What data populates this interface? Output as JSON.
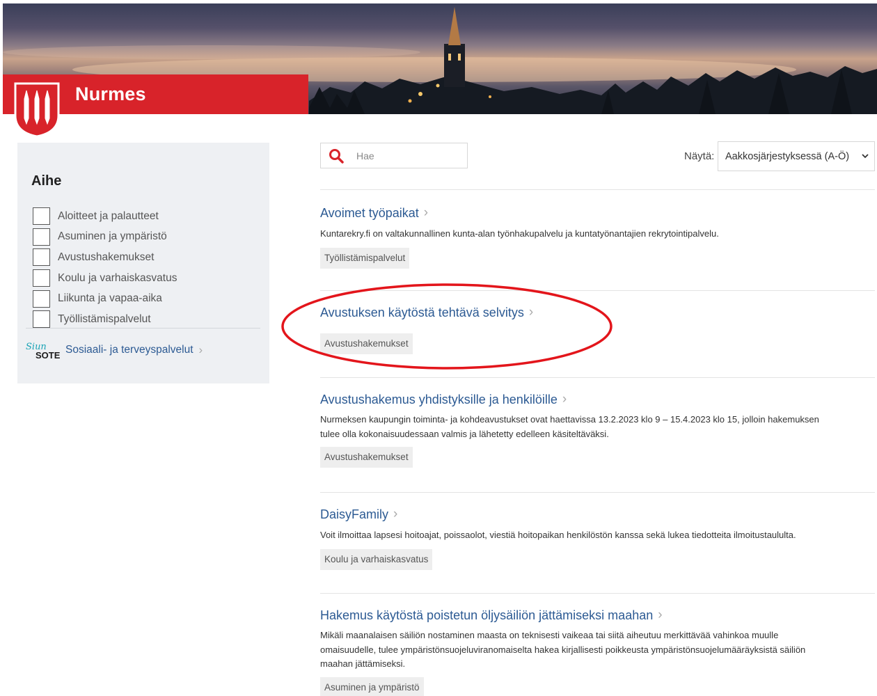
{
  "brand": {
    "title": "Nurmes"
  },
  "sidebar": {
    "heading": "Aihe",
    "filters": [
      {
        "label": "Aloitteet ja palautteet"
      },
      {
        "label": "Asuminen ja ympäristö"
      },
      {
        "label": "Avustushakemukset"
      },
      {
        "label": "Koulu ja varhaiskasvatus"
      },
      {
        "label": "Liikunta ja vapaa-aika"
      },
      {
        "label": "Työllistämispalvelut"
      }
    ],
    "sote_link": {
      "label": "Sosiaali- ja terveyspalvelut",
      "logo_text": "SOTE",
      "logo_script": "Siun"
    }
  },
  "search": {
    "placeholder": "Hae"
  },
  "sort": {
    "label": "Näytä:",
    "value": "Aakkosjärjestyksessä (A-Ö)"
  },
  "results": [
    {
      "title": "Avoimet työpaikat",
      "desc_lines": [
        "Kuntarekry.fi on valtakunnallinen kunta-alan työnhakupalvelu ja kuntatyönantajien rekrytointipalvelu."
      ],
      "tag": "Työllistämispalvelut"
    },
    {
      "title": "Avustuksen käytöstä tehtävä selvitys",
      "desc_lines": [],
      "tag": "Avustushakemukset"
    },
    {
      "title": "Avustushakemus yhdistyksille ja henkilöille",
      "desc_lines": [
        "Nurmeksen kaupungin toiminta- ja kohdeavustukset ovat haettavissa 13.2.2023 klo 9 – 15.4.2023 klo 15, jolloin hakemuksen",
        "tulee olla kokonaisuudessaan valmis ja lähetetty edelleen käsiteltäväksi."
      ],
      "tag": "Avustushakemukset"
    },
    {
      "title": "DaisyFamily",
      "desc_lines": [
        "Voit ilmoittaa lapsesi hoitoajat, poissaolot, viestiä hoitopaikan henkilöstön kanssa sekä lukea tiedotteita ilmoitustaululta."
      ],
      "tag": "Koulu ja varhaiskasvatus"
    },
    {
      "title": "Hakemus käytöstä poistetun öljysäiliön jättämiseksi maahan",
      "desc_lines": [
        "Mikäli maanalaisen säiliön nostaminen maasta on teknisesti vaikeaa tai siitä aiheutuu merkittävää vahinkoa muulle",
        "omaisuudelle, tulee ympäristönsuojeluviranomaiselta hakea kirjallisesti poikkeusta ympäristönsuojelumääräyksistä säiliön",
        "maahan jättämiseksi."
      ],
      "tag": "Asuminen ja ympäristö"
    }
  ],
  "colors": {
    "brand_red": "#d8232a",
    "link_blue": "#2c5a93",
    "annotation_red": "#e3151b"
  }
}
